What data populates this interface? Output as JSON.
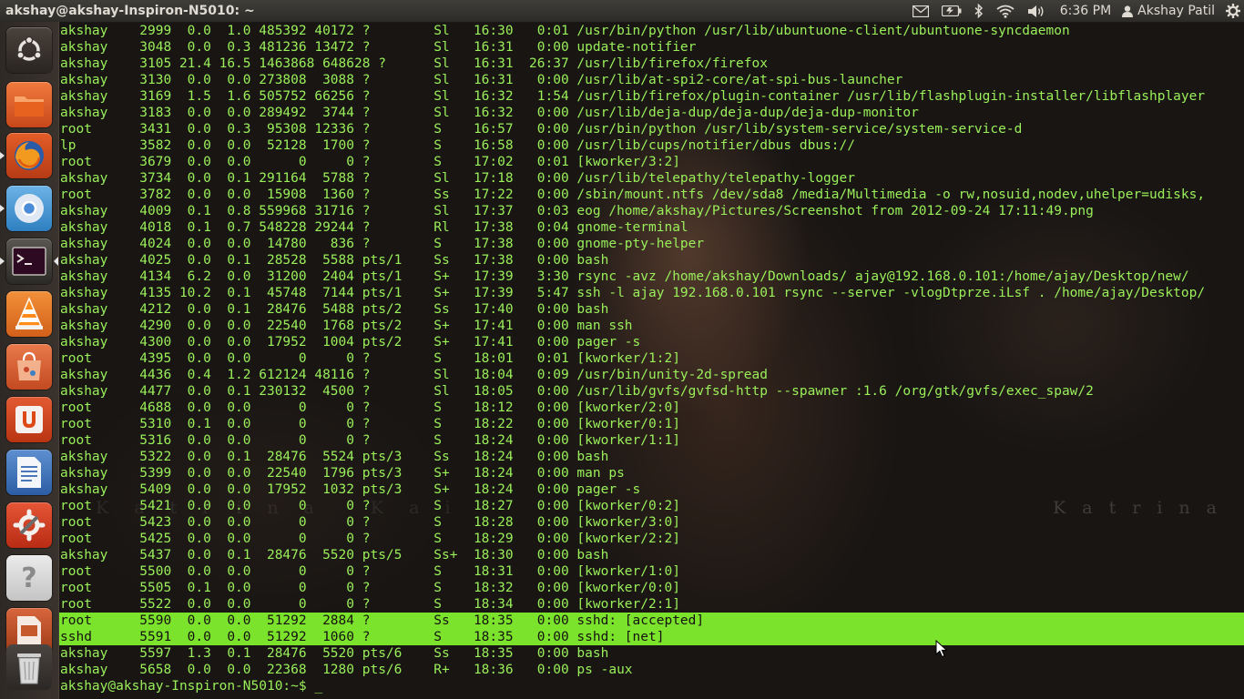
{
  "panel": {
    "window_title": "akshay@akshay-Inspiron-N5010: ~",
    "clock": "6:36 PM",
    "user": "Akshay Patil"
  },
  "launcher": {
    "items": [
      {
        "name": "dash-home-icon"
      },
      {
        "name": "home-folder-icon"
      },
      {
        "name": "firefox-icon"
      },
      {
        "name": "chromium-icon"
      },
      {
        "name": "terminal-icon"
      },
      {
        "name": "vlc-icon"
      },
      {
        "name": "software-center-icon"
      },
      {
        "name": "ubuntu-one-icon"
      },
      {
        "name": "libreoffice-writer-icon"
      },
      {
        "name": "system-settings-icon"
      },
      {
        "name": "help-icon"
      },
      {
        "name": "libreoffice-impress-icon"
      },
      {
        "name": "trash-icon"
      }
    ]
  },
  "wallpaper": {
    "text_right": "Katrina",
    "text_left": "Katrina Kai"
  },
  "terminal": {
    "lines": [
      "akshay    2999  0.0  1.0 485392 40172 ?        Sl   16:30   0:01 /usr/bin/python /usr/lib/ubuntuone-client/ubuntuone-syncdaemon",
      "akshay    3048  0.0  0.3 481236 13472 ?        Sl   16:31   0:00 update-notifier",
      "akshay    3105 21.4 16.5 1463868 648628 ?      Sl   16:31  26:37 /usr/lib/firefox/firefox",
      "akshay    3130  0.0  0.0 273808  3088 ?        Sl   16:31   0:00 /usr/lib/at-spi2-core/at-spi-bus-launcher",
      "akshay    3169  1.5  1.6 505752 66256 ?        Sl   16:32   1:54 /usr/lib/firefox/plugin-container /usr/lib/flashplugin-installer/libflashplayer",
      "akshay    3183  0.0  0.0 289492  3744 ?        Sl   16:32   0:00 /usr/lib/deja-dup/deja-dup/deja-dup-monitor",
      "root      3431  0.0  0.3  95308 12336 ?        S    16:57   0:00 /usr/bin/python /usr/lib/system-service/system-service-d",
      "lp        3582  0.0  0.0  52128  1700 ?        S    16:58   0:00 /usr/lib/cups/notifier/dbus dbus://",
      "root      3679  0.0  0.0      0     0 ?        S    17:02   0:01 [kworker/3:2]",
      "akshay    3734  0.0  0.1 291164  5788 ?        Sl   17:18   0:00 /usr/lib/telepathy/telepathy-logger",
      "root      3782  0.0  0.0  15908  1360 ?        Ss   17:22   0:00 /sbin/mount.ntfs /dev/sda8 /media/Multimedia -o rw,nosuid,nodev,uhelper=udisks,",
      "akshay    4009  0.1  0.8 559968 31716 ?        Sl   17:37   0:03 eog /home/akshay/Pictures/Screenshot from 2012-09-24 17:11:49.png",
      "akshay    4018  0.1  0.7 548228 29244 ?        Rl   17:38   0:04 gnome-terminal",
      "akshay    4024  0.0  0.0  14780   836 ?        S    17:38   0:00 gnome-pty-helper",
      "akshay    4025  0.0  0.1  28528  5588 pts/1    Ss   17:38   0:00 bash",
      "akshay    4134  6.2  0.0  31200  2404 pts/1    S+   17:39   3:30 rsync -avz /home/akshay/Downloads/ ajay@192.168.0.101:/home/ajay/Desktop/new/",
      "akshay    4135 10.2  0.1  45748  7144 pts/1    S+   17:39   5:47 ssh -l ajay 192.168.0.101 rsync --server -vlogDtprze.iLsf . /home/ajay/Desktop/",
      "akshay    4212  0.0  0.1  28476  5488 pts/2    Ss   17:40   0:00 bash",
      "akshay    4290  0.0  0.0  22540  1768 pts/2    S+   17:41   0:00 man ssh",
      "akshay    4300  0.0  0.0  17952  1004 pts/2    S+   17:41   0:00 pager -s",
      "root      4395  0.0  0.0      0     0 ?        S    18:01   0:01 [kworker/1:2]",
      "akshay    4436  0.4  1.2 612124 48116 ?        Sl   18:04   0:09 /usr/bin/unity-2d-spread",
      "akshay    4477  0.0  0.1 230132  4500 ?        Sl   18:05   0:00 /usr/lib/gvfs/gvfsd-http --spawner :1.6 /org/gtk/gvfs/exec_spaw/2",
      "root      4688  0.0  0.0      0     0 ?        S    18:12   0:00 [kworker/2:0]",
      "root      5310  0.1  0.0      0     0 ?        S    18:22   0:00 [kworker/0:1]",
      "root      5316  0.0  0.0      0     0 ?        S    18:24   0:00 [kworker/1:1]",
      "akshay    5322  0.0  0.1  28476  5524 pts/3    Ss   18:24   0:00 bash",
      "akshay    5399  0.0  0.0  22540  1796 pts/3    S+   18:24   0:00 man ps",
      "akshay    5409  0.0  0.0  17952  1032 pts/3    S+   18:24   0:00 pager -s",
      "root      5421  0.0  0.0      0     0 ?        S    18:27   0:00 [kworker/0:2]",
      "root      5423  0.0  0.0      0     0 ?        S    18:28   0:00 [kworker/3:0]",
      "root      5425  0.0  0.0      0     0 ?        S    18:29   0:00 [kworker/2:2]",
      "akshay    5437  0.0  0.1  28476  5520 pts/5    Ss+  18:30   0:00 bash",
      "root      5500  0.0  0.0      0     0 ?        S    18:31   0:00 [kworker/1:0]",
      "root      5505  0.1  0.0      0     0 ?        S    18:32   0:00 [kworker/0:0]",
      "root      5522  0.0  0.0      0     0 ?        S    18:34   0:00 [kworker/2:1]",
      "root      5590  0.0  0.0  51292  2884 ?        Ss   18:35   0:00 sshd: [accepted]",
      "sshd      5591  0.0  0.0  51292  1060 ?        S    18:35   0:00 sshd: [net]",
      "akshay    5597  1.3  0.1  28476  5520 pts/6    Ss   18:35   0:00 bash",
      "akshay    5658  0.0  0.0  22368  1280 pts/6    R+   18:36   0:00 ps -aux"
    ],
    "highlighted": [
      36,
      37
    ],
    "prompt": "akshay@akshay-Inspiron-N5010:~$ ",
    "cursor": "_"
  },
  "colors": {
    "terminal_text": "#9bf05a",
    "selection": "#7ce32d",
    "panel": "#3c3b37",
    "launcher": "#332d28"
  }
}
